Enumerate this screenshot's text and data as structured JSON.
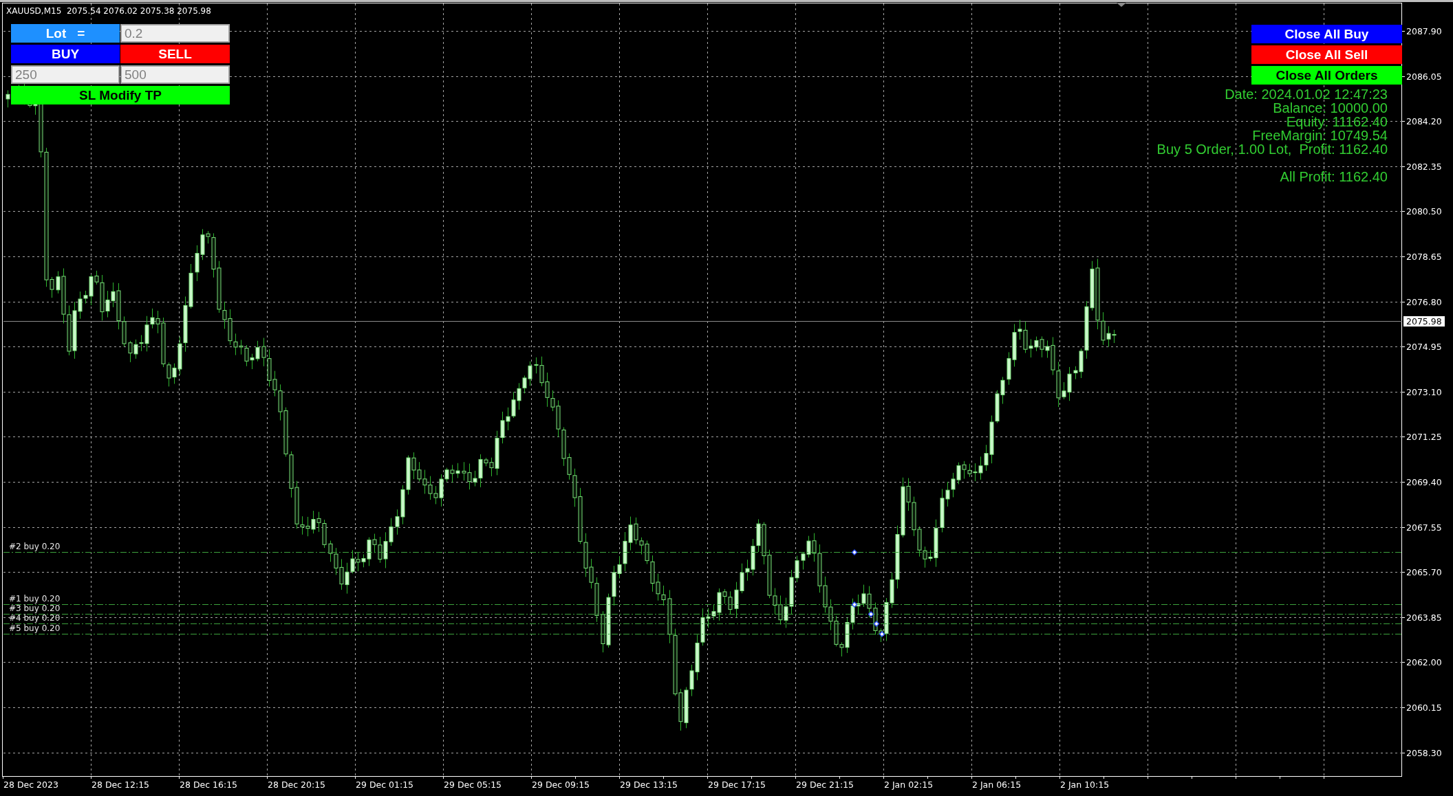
{
  "chart": {
    "header": "XAUUSD,M15  2075.54 2076.02 2075.38 2075.98"
  },
  "trade_panel": {
    "rows": [
      {
        "cells": [
          {
            "kind": "label",
            "text": "Lot   =",
            "color": "#1e90ff"
          },
          {
            "kind": "field",
            "value": "0.2"
          }
        ]
      },
      {
        "cells": [
          {
            "kind": "button",
            "label": "BUY",
            "color": "#0000ff"
          },
          {
            "kind": "button",
            "label": "SELL",
            "color": "#ff0000"
          }
        ]
      },
      {
        "cells": [
          {
            "kind": "field",
            "value": "250"
          },
          {
            "kind": "field",
            "value": "500"
          }
        ]
      },
      {
        "cells": [
          {
            "kind": "button",
            "label": "SL Modify TP",
            "color": "#00ff00"
          }
        ]
      }
    ]
  },
  "close_buttons": [
    {
      "label": "Close All Buy",
      "color": "#0000ff"
    },
    {
      "label": "Close All Sell",
      "color": "#ff0000"
    },
    {
      "label": "Close All Orders",
      "color": "#00ff00"
    }
  ],
  "account_info": {
    "lines": [
      "Date: 2024.01.02 12:47:23",
      "Balance: 10000.00",
      "Equity: 11162.40",
      "FreeMargin: 10749.54",
      "Buy 5 Order, 1.00 Lot,  Profit: 1162.40"
    ],
    "total": "All Profit: 1162.40"
  },
  "orders": [
    {
      "label": "#2 buy 0.20"
    },
    {
      "label": "#1 buy 0.20"
    },
    {
      "label": "#3 buy 0.20"
    },
    {
      "label": "#4 buy 0.20"
    },
    {
      "label": "#5 buy 0.20"
    }
  ],
  "price_axis": {
    "labels": [
      "2087.90",
      "2086.05",
      "2084.20",
      "2082.35",
      "2080.50",
      "2078.65",
      "2076.80",
      "2074.95",
      "2073.10",
      "2071.25",
      "2069.40",
      "2067.55",
      "2065.70",
      "2063.85",
      "2062.00",
      "2060.15",
      "2058.30"
    ],
    "current_price": "2075.98"
  },
  "time_axis": {
    "labels": [
      "28 Dec 2023",
      "28 Dec 12:15",
      "28 Dec 16:15",
      "28 Dec 20:15",
      "29 Dec 01:15",
      "29 Dec 05:15",
      "29 Dec 09:15",
      "29 Dec 13:15",
      "29 Dec 17:15",
      "29 Dec 21:15",
      "2 Jan 02:15",
      "2 Jan 06:15",
      "2 Jan 10:15"
    ]
  }
}
